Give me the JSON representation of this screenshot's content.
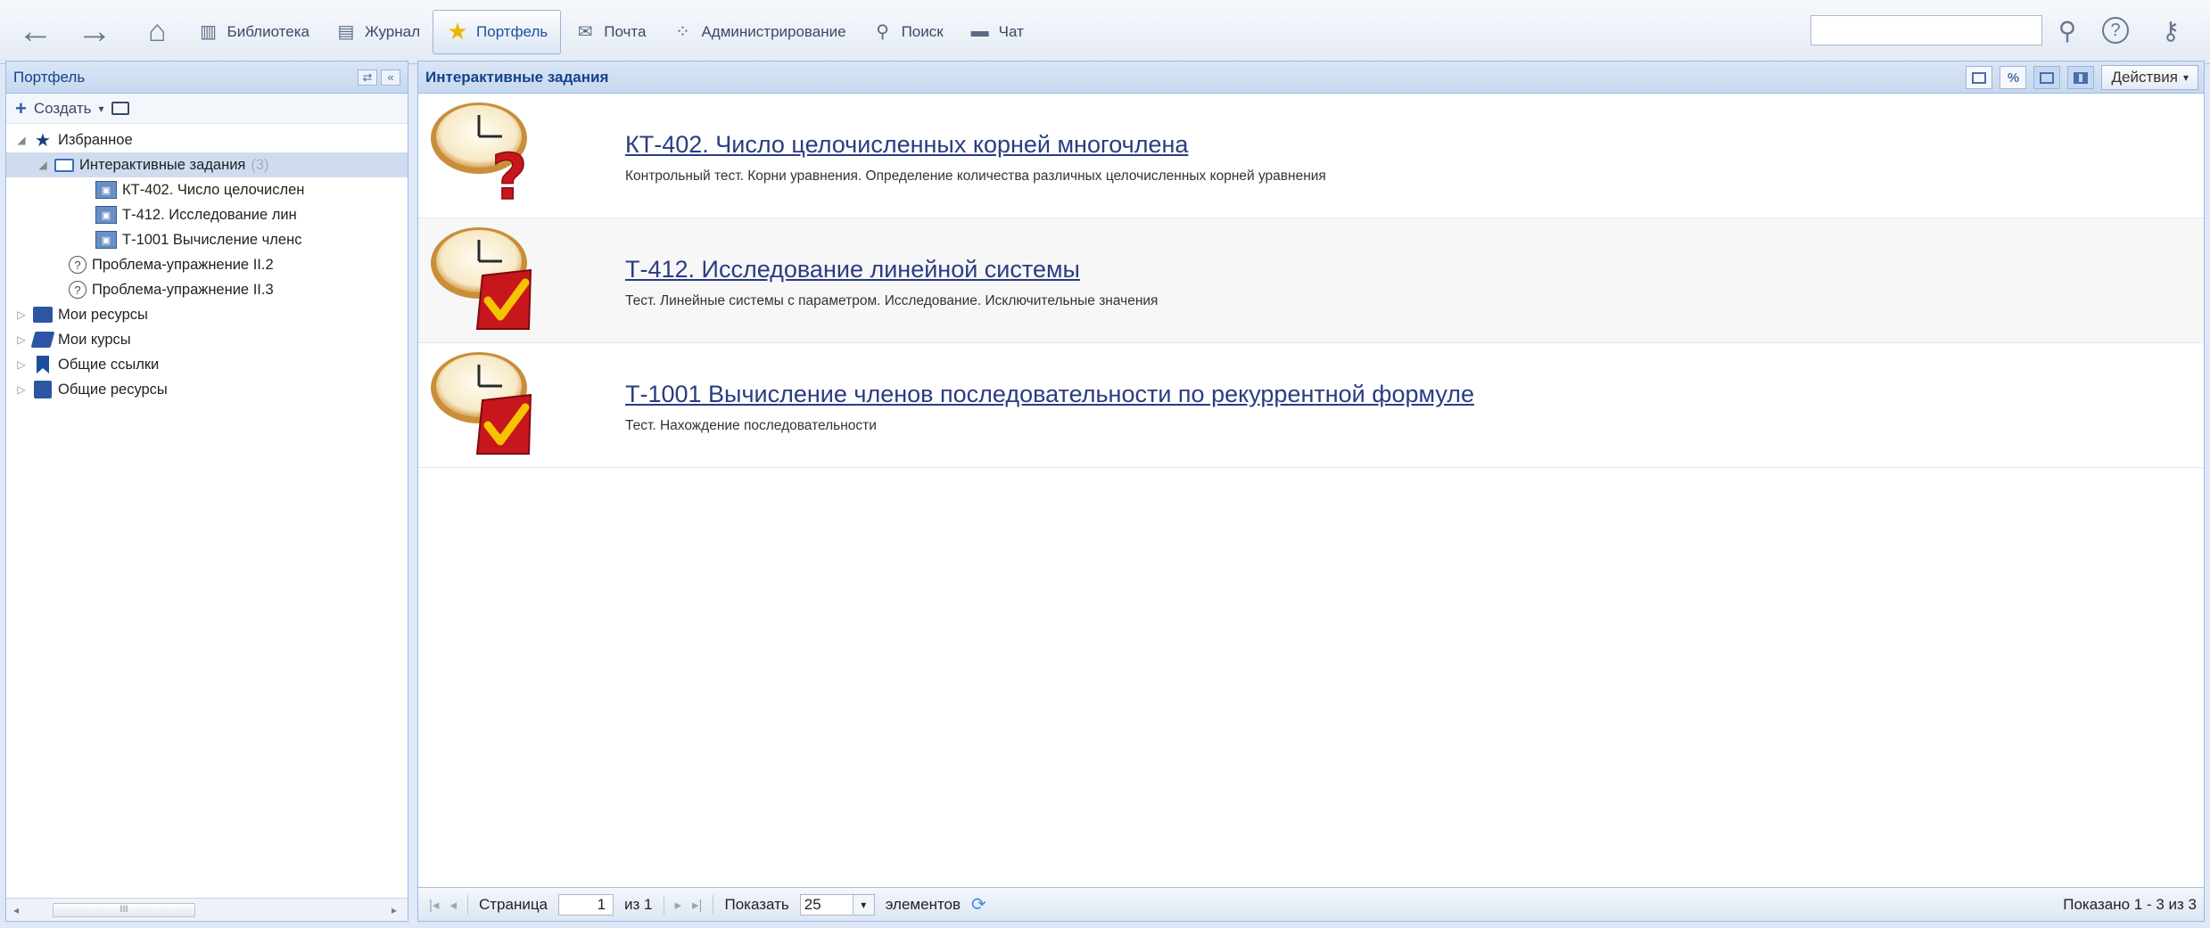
{
  "toolbar": {
    "back_icon": "←",
    "forward_icon": "→",
    "home_icon": "⌂",
    "items": [
      {
        "label": "Библиотека",
        "icon": "library-icon"
      },
      {
        "label": "Журнал",
        "icon": "journal-icon"
      },
      {
        "label": "Портфель",
        "icon": "star-icon",
        "active": true
      },
      {
        "label": "Почта",
        "icon": "mail-icon"
      },
      {
        "label": "Администрирование",
        "icon": "admin-icon"
      },
      {
        "label": "Поиск",
        "icon": "search-icon"
      },
      {
        "label": "Чат",
        "icon": "chat-icon"
      }
    ],
    "search_value": ""
  },
  "left_panel": {
    "title": "Портфель",
    "create_label": "Создать",
    "tree": [
      {
        "label": "Избранное",
        "icon": "star-icon",
        "level": 0,
        "toggle": "◢"
      },
      {
        "label": "Интерактивные задания",
        "count": "(3)",
        "icon": "folder-open-icon",
        "level": 1,
        "toggle": "◢",
        "selected": true
      },
      {
        "label": "КТ-402. Число целочислен",
        "icon": "test-doc-icon",
        "level": 2
      },
      {
        "label": "Т-412. Исследование лин",
        "icon": "test-doc-icon",
        "level": 2
      },
      {
        "label": "Т-1001 Вычисление членс",
        "icon": "test-doc-icon",
        "level": 2
      },
      {
        "label": "Проблема-упражнение II.2",
        "icon": "help-icon",
        "level": 1
      },
      {
        "label": "Проблема-упражнение II.3",
        "icon": "help-icon",
        "level": 1
      },
      {
        "label": "Мои ресурсы",
        "icon": "resources-icon",
        "level": 0,
        "toggle": "▷"
      },
      {
        "label": "Мои курсы",
        "icon": "courses-icon",
        "level": 0,
        "toggle": "▷"
      },
      {
        "label": "Общие ссылки",
        "icon": "bookmark-icon",
        "level": 0,
        "toggle": "▷"
      },
      {
        "label": "Общие ресурсы",
        "icon": "shared-resources-icon",
        "level": 0,
        "toggle": "▷"
      }
    ]
  },
  "main_panel": {
    "title": "Интерактивные задания",
    "actions_label": "Действия",
    "items": [
      {
        "title": "КТ-402. Число целочисленных корней многочлена",
        "description": "Контрольный тест. Корни уравнения. Определение количества различных целочисленных корней уравнения",
        "badge": "question"
      },
      {
        "title": "Т-412. Исследование линейной системы",
        "description": "Тест. Линейные системы с параметром. Исследование. Исключительные значения",
        "badge": "check"
      },
      {
        "title": "Т-1001 Вычисление членов последовательности по рекуррентной формуле",
        "description": "Тест. Нахождение последовательности",
        "badge": "check"
      }
    ]
  },
  "pager": {
    "page_label": "Страница",
    "page_value": "1",
    "of_label": "из 1",
    "show_label": "Показать",
    "page_size": "25",
    "elements_label": "элементов",
    "shown_text": "Показано 1 - 3 из 3"
  },
  "colors": {
    "accent": "#15428b",
    "link": "#2a3c82",
    "panel_border": "#99bbe8",
    "badge_red": "#c8161d",
    "badge_gold": "#f5c400"
  }
}
